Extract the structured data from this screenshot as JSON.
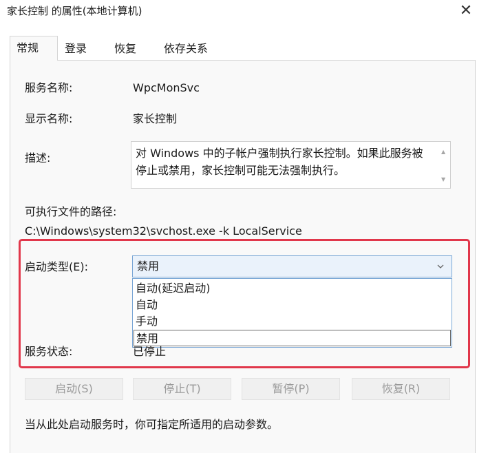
{
  "window": {
    "title": "家长控制 的属性(本地计算机)",
    "close_icon": "close-icon"
  },
  "tabs": [
    {
      "label": "常规",
      "active": true
    },
    {
      "label": "登录"
    },
    {
      "label": "恢复"
    },
    {
      "label": "依存关系"
    }
  ],
  "general": {
    "service_name_label": "服务名称:",
    "service_name": "WpcMonSvc",
    "display_name_label": "显示名称:",
    "display_name": "家长控制",
    "description_label": "描述:",
    "description": "对 Windows 中的子帐户强制执行家长控制。如果此服务被停止或禁用，家长控制可能无法强制执行。",
    "exe_path_label": "可执行文件的路径:",
    "exe_path": "C:\\Windows\\system32\\svchost.exe -k LocalService",
    "startup_type_label": "启动类型(E):",
    "startup_type_value": "禁用",
    "startup_options": [
      "自动(延迟启动)",
      "自动",
      "手动",
      "禁用"
    ],
    "service_status_label": "服务状态:",
    "service_status": "已停止",
    "buttons": {
      "start": "启动(S)",
      "stop": "停止(T)",
      "pause": "暂停(P)",
      "resume": "恢复(R)"
    },
    "hint": "当从此处启动服务时，你可指定所适用的启动参数。"
  },
  "colors": {
    "highlight_border": "#e1374b",
    "select_background": "#eaf2fb",
    "select_border": "#7aa7d6"
  }
}
